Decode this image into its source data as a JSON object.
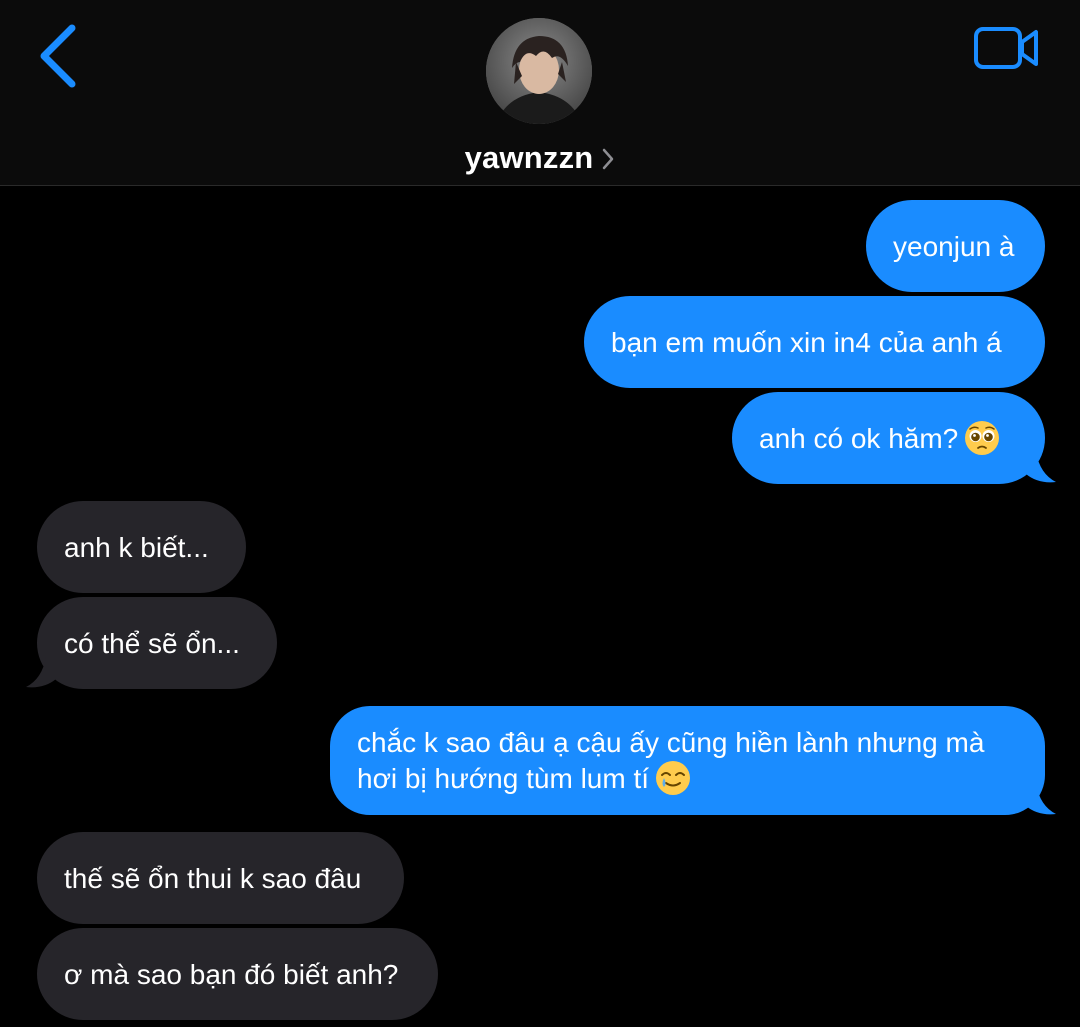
{
  "header": {
    "contact_name": "yawnzzn",
    "back_icon": "chevron-left-icon",
    "video_icon": "video-camera-icon",
    "accent_color": "#1a8cff"
  },
  "messages": [
    {
      "direction": "outgoing",
      "text": "yeonjun à"
    },
    {
      "direction": "outgoing",
      "text": "bạn em muốn xin in4 của anh á"
    },
    {
      "direction": "outgoing",
      "text": "anh có ok hăm?",
      "emoji": "pleading-face"
    },
    {
      "direction": "incoming",
      "text": "anh k biết..."
    },
    {
      "direction": "incoming",
      "text": "có thể sẽ ổn..."
    },
    {
      "direction": "outgoing",
      "text": "chắc k sao đâu ạ cậu ấy cũng hiền lành nhưng mà hơi bị hướng tùm lum tí",
      "emoji": "smiling-face-with-tear"
    },
    {
      "direction": "incoming",
      "text": "thế sẽ ổn thui k sao đâu"
    },
    {
      "direction": "incoming",
      "text": "ơ mà sao bạn đó biết anh?"
    }
  ],
  "colors": {
    "outgoing_bubble": "#1a8cff",
    "incoming_bubble": "#26252a",
    "background": "#000000"
  }
}
